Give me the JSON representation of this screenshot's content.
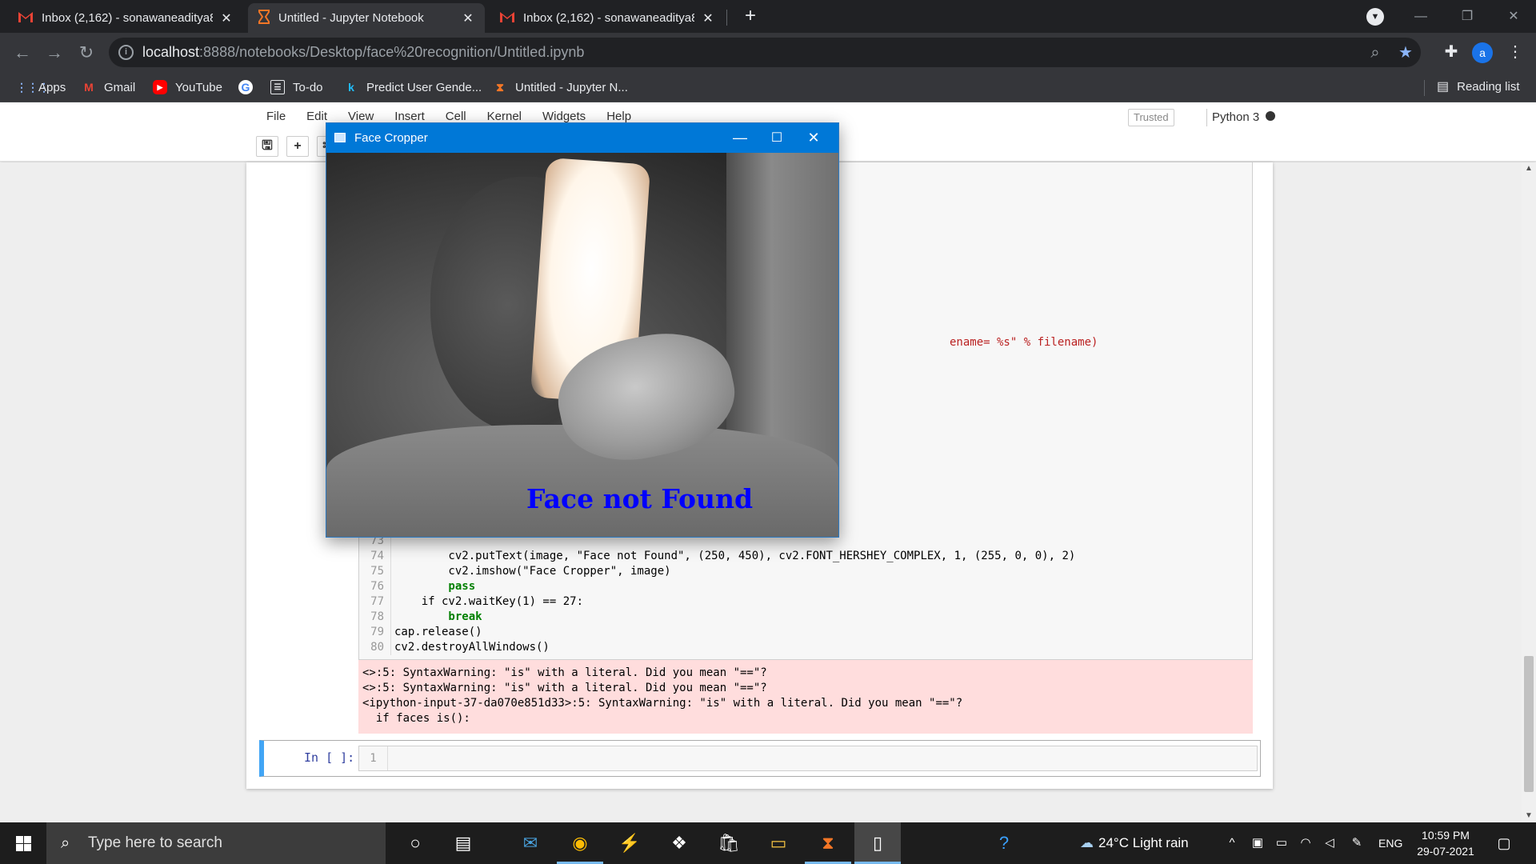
{
  "browser": {
    "tabs": [
      {
        "title": "Inbox (2,162) - sonawaneaditya8",
        "icon": "gmail-icon",
        "active": false
      },
      {
        "title": "Untitled - Jupyter Notebook",
        "icon": "jupyter-icon",
        "active": true
      },
      {
        "title": "Inbox (2,162) - sonawaneaditya8",
        "icon": "gmail-icon",
        "active": false
      }
    ],
    "new_tab": "+",
    "url_host": "localhost",
    "url_path": ":8888/notebooks/Desktop/face%20recognition/Untitled.ipynb",
    "avatar_letter": "a",
    "bookmarks": [
      {
        "label": "Apps",
        "icon": "apps-grid-icon"
      },
      {
        "label": "Gmail",
        "icon": "gmail-icon"
      },
      {
        "label": "YouTube",
        "icon": "youtube-icon"
      },
      {
        "label": "",
        "icon": "google-icon"
      },
      {
        "label": "To-do",
        "icon": "todo-icon"
      },
      {
        "label": "Predict User Gende...",
        "icon": "kaggle-icon"
      },
      {
        "label": "Untitled - Jupyter N...",
        "icon": "jupyter-icon"
      }
    ],
    "reading_list": "Reading list"
  },
  "jupyter": {
    "menu": [
      "File",
      "Edit",
      "View",
      "Insert",
      "Cell",
      "Kernel",
      "Widgets",
      "Help"
    ],
    "trusted": "Trusted",
    "kernel": "Python 3",
    "partial_line": "ename= %s\" % filename)",
    "code_lines": [
      {
        "n": "73",
        "text": ""
      },
      {
        "n": "74",
        "text": "        cv2.putText(image, \"Face not Found\", (250, 450), cv2.FONT_HERSHEY_COMPLEX, 1, (255, 0, 0), 2)"
      },
      {
        "n": "75",
        "text": "        cv2.imshow(\"Face Cropper\", image)"
      },
      {
        "n": "76",
        "text": "        pass"
      },
      {
        "n": "77",
        "text": "    if cv2.waitKey(1) == 27:"
      },
      {
        "n": "78",
        "text": "        break"
      },
      {
        "n": "79",
        "text": "cap.release()"
      },
      {
        "n": "80",
        "text": "cv2.destroyAllWindows()"
      }
    ],
    "stderr": [
      "<>:5: SyntaxWarning: \"is\" with a literal. Did you mean \"==\"?",
      "<>:5: SyntaxWarning: \"is\" with a literal. Did you mean \"==\"?",
      "<ipython-input-37-da070e851d33>:5: SyntaxWarning: \"is\" with a literal. Did you mean \"==\"?",
      "  if faces is():"
    ],
    "input_prompt": "In [ ]:",
    "input_line_number": "1"
  },
  "face_window": {
    "title": "Face Cropper",
    "overlay_text": "Face not Found",
    "overlay_color": "#0000ff"
  },
  "taskbar": {
    "search_placeholder": "Type here to search",
    "weather": "24°C  Light rain",
    "language": "ENG",
    "time": "10:59 PM",
    "date": "29-07-2021"
  }
}
